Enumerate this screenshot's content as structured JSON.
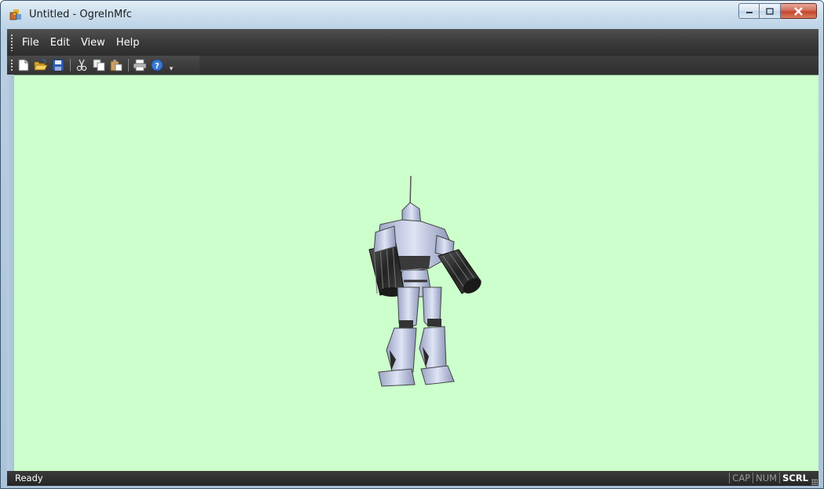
{
  "window": {
    "title": "Untitled - OgreInMfc"
  },
  "menu": {
    "items": [
      "File",
      "Edit",
      "View",
      "Help"
    ]
  },
  "toolbar": {
    "buttons": [
      "new-icon",
      "open-icon",
      "save-icon",
      "cut-icon",
      "copy-icon",
      "paste-icon",
      "print-icon",
      "help-icon"
    ]
  },
  "view": {
    "background": "#ccffcc"
  },
  "status": {
    "text": "Ready",
    "indicators": [
      "CAP",
      "NUM",
      "SCRL"
    ],
    "active": [
      "SCRL"
    ]
  }
}
